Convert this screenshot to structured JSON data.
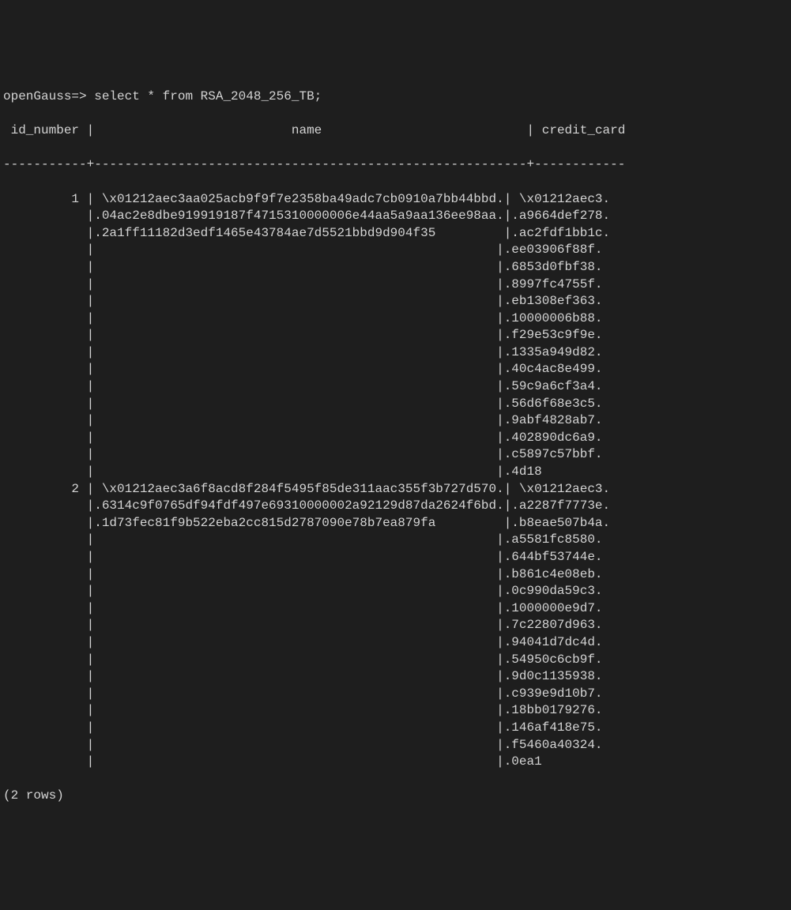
{
  "prompt": "openGauss=> ",
  "query": "select * from RSA_2048_256_TB;",
  "headers": {
    "col1": " id_number ",
    "col2": "                          name                           ",
    "col3": " credit_card"
  },
  "separator_line": "-----------+---------------------------------------------------------+------------",
  "rows": [
    {
      "id": "         1 ",
      "name_lines": [
        " \\x01212aec3aa025acb9f9f7e2358ba49adc7cb0910a7bb44bbd.",
        ".04ac2e8dbe919919187f4715310000006e44aa5a9aa136ee98aa.",
        ".2a1ff11182d3edf1465e43784ae7d5521bbd9d904f35         "
      ],
      "credit_lines": [
        " \\x01212aec3.",
        ".a9664def278.",
        ".ac2fdf1bb1c.",
        ".ee03906f88f.",
        ".6853d0fbf38.",
        ".8997fc4755f.",
        ".eb1308ef363.",
        ".10000006b88.",
        ".f29e53c9f9e.",
        ".1335a949d82.",
        ".40c4ac8e499.",
        ".59c9a6cf3a4.",
        ".56d6f68e3c5.",
        ".9abf4828ab7.",
        ".402890dc6a9.",
        ".c5897c57bbf.",
        ".4d18"
      ]
    },
    {
      "id": "         2 ",
      "name_lines": [
        " \\x01212aec3a6f8acd8f284f5495f85de311aac355f3b727d570.",
        ".6314c9f0765df94fdf497e69310000002a92129d87da2624f6bd.",
        ".1d73fec81f9b522eba2cc815d2787090e78b7ea879fa         "
      ],
      "credit_lines": [
        " \\x01212aec3.",
        ".a2287f7773e.",
        ".b8eae507b4a.",
        ".a5581fc8580.",
        ".644bf53744e.",
        ".b861c4e08eb.",
        ".0c990da59c3.",
        ".1000000e9d7.",
        ".7c22807d963.",
        ".94041d7dc4d.",
        ".54950c6cb9f.",
        ".9d0c1135938.",
        ".c939e9d10b7.",
        ".18bb0179276.",
        ".146af418e75.",
        ".f5460a40324.",
        ".0ea1"
      ]
    }
  ],
  "footer": "(2 rows)",
  "blank_id": "           ",
  "blank_name": "                                                     "
}
